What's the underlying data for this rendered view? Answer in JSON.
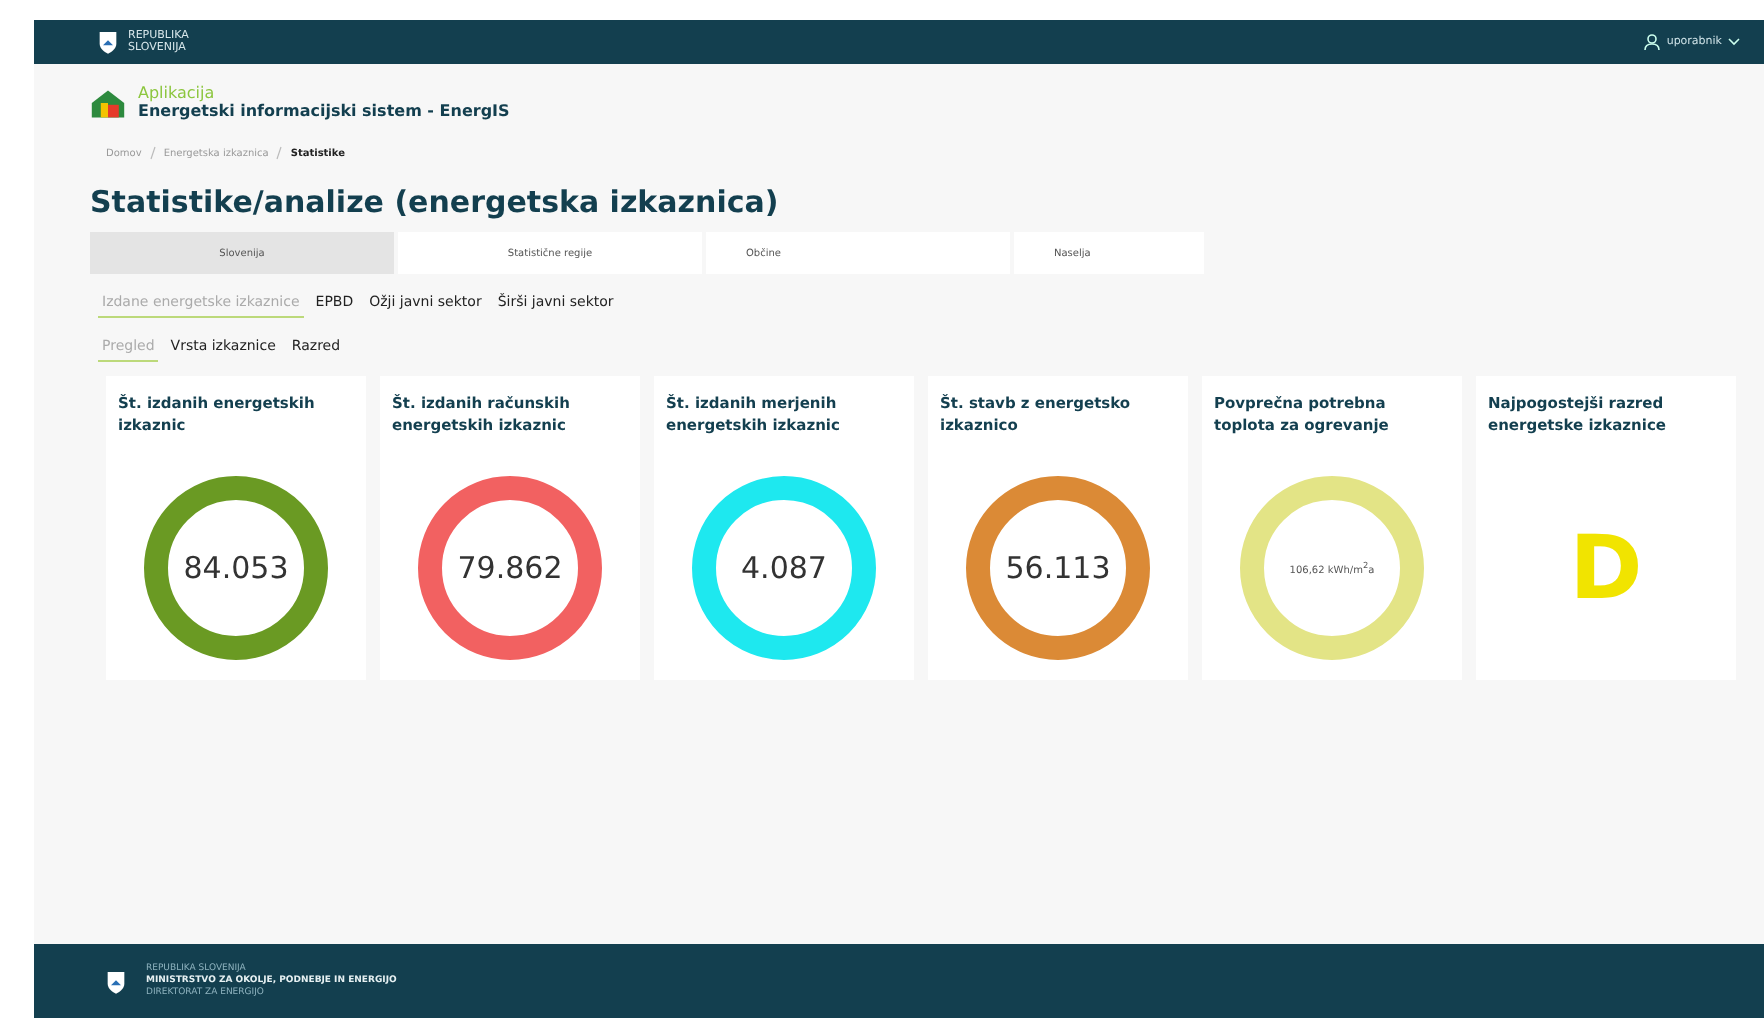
{
  "header": {
    "brand": [
      "REPUBLIKA",
      "SLOVENIJA"
    ],
    "user": "uporabnik"
  },
  "app": {
    "label": "Aplikacija",
    "title": "Energetski informacijski sistem - EnergIS"
  },
  "breadcrumb": [
    {
      "label": "Domov",
      "selected": false
    },
    {
      "label": "Energetska izkaznica",
      "selected": false
    },
    {
      "label": "Statistike",
      "selected": true
    }
  ],
  "page_title": "Statistike/analize (energetska izkaznica)",
  "tabs": [
    {
      "label": "Slovenija",
      "selected": true
    },
    {
      "label": "Statistične regije",
      "selected": false
    },
    {
      "label": "Občine",
      "selected": false
    },
    {
      "label": "Naselja",
      "selected": false
    }
  ],
  "subtabs": [
    {
      "label": "Izdane energetske izkaznice",
      "selected": true
    },
    {
      "label": "EPBD",
      "selected": false
    },
    {
      "label": "Ožji javni sektor",
      "selected": false
    },
    {
      "label": "Širši javni sektor",
      "selected": false
    }
  ],
  "views": [
    {
      "label": "Pregled",
      "selected": true
    },
    {
      "label": "Vrsta izkaznice",
      "selected": false
    },
    {
      "label": "Razred",
      "selected": false
    }
  ],
  "cards": [
    {
      "title": "Št. izdanih energetskih izkaznic",
      "value": "84.053",
      "kind": "ring",
      "color": "#6a9a23"
    },
    {
      "title": "Št. izdanih računskih energetskih izkaznic",
      "value": "79.862",
      "kind": "ring",
      "color": "#f26161"
    },
    {
      "title": "Št. izdanih merjenih energetskih izkaznic",
      "value": "4.087",
      "kind": "ring",
      "color": "#1ee8ef"
    },
    {
      "title": "Št. stavb z energetsko izkaznico",
      "value": "56.113",
      "kind": "ring",
      "color": "#db8a36"
    },
    {
      "title": "Povprečna potrebna toplota za ogrevanje",
      "value": "106,62 kWh/m$^{2}$a",
      "kind": "ring-small",
      "color": "#e3e486"
    },
    {
      "title": "Najpogostejši razred energetske izkaznice",
      "value": "D",
      "kind": "letter",
      "color": "#f1e400"
    }
  ],
  "footer": {
    "lines": [
      "REPUBLIKA SLOVENIJA",
      "MINISTRSTVO ZA OKOLJE, PODNEBJE IN ENERGIJO",
      "DIREKTORAT ZA ENERGIJO"
    ]
  }
}
